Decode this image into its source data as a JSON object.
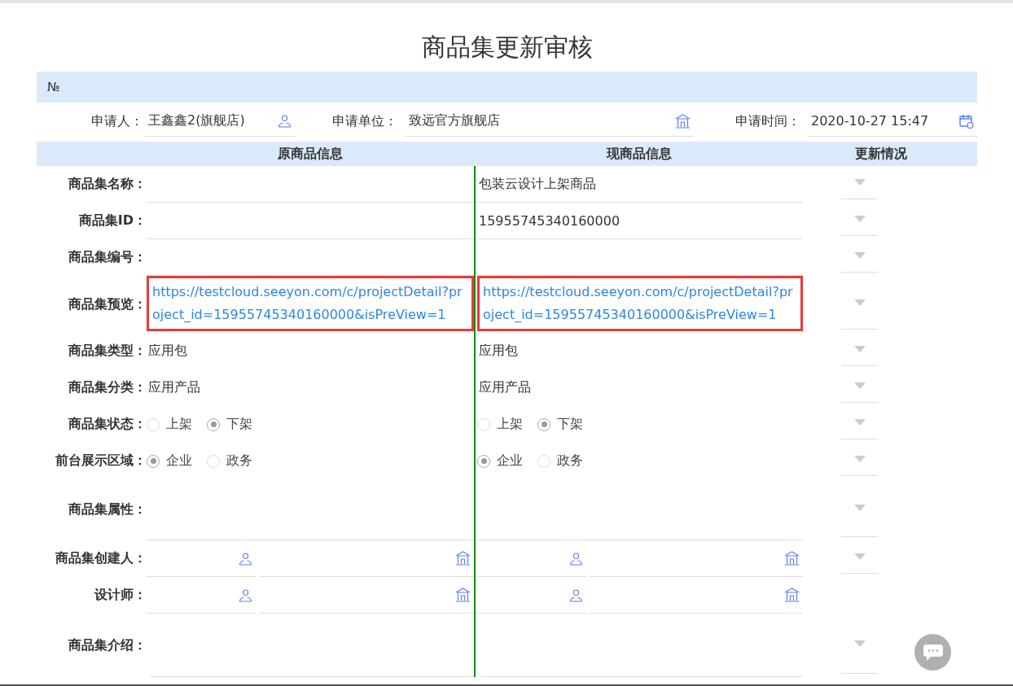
{
  "title": "商品集更新审核",
  "number_label": "№",
  "applicant_fields": [
    {
      "label": "申请人：",
      "value": "王鑫鑫2(旗舰店)"
    },
    {
      "label": "申请单位：",
      "value": "致远官方旗舰店"
    },
    {
      "label": "申请时间：",
      "value": "2020-10-27 15:47"
    }
  ],
  "headers": [
    "原商品信息",
    "现商品信息",
    "更新情况"
  ],
  "rows": [
    {
      "label": "商品集名称：",
      "kind": "text",
      "original": {},
      "current": {
        "value": "包装云设计上架商品"
      },
      "dropdown": true
    },
    {
      "label": "商品集ID：",
      "kind": "text",
      "original": {},
      "current": {
        "value": "15955745340160000"
      },
      "dropdown": true
    },
    {
      "label": "商品集编号：",
      "kind": "text",
      "original": {},
      "current": {},
      "dropdown": true
    },
    {
      "label": "商品集预览：",
      "kind": "link",
      "original": {
        "value": "https://testcloud.seeyon.com/c/projectDetail?project_id=15955745340160000&isPreView=1",
        "highlighted": true
      },
      "current": {
        "value": "https://testcloud.seeyon.com/c/projectDetail?project_id=15955745340160000&isPreView=1",
        "highlighted": true
      },
      "dropdown": true
    },
    {
      "label": "商品集类型：",
      "kind": "plain",
      "original": {
        "value": "应用包"
      },
      "current": {
        "value": "应用包"
      },
      "dropdown": true
    },
    {
      "label": "商品集分类：",
      "kind": "plain",
      "original": {
        "value": "应用产品"
      },
      "current": {
        "value": "应用产品"
      },
      "dropdown": true
    },
    {
      "label": "商品集状态：",
      "kind": "radio",
      "original": {
        "options": [
          {
            "label": "上架",
            "selected": false
          },
          {
            "label": "下架",
            "selected": true
          }
        ]
      },
      "current": {
        "options": [
          {
            "label": "上架",
            "selected": false
          },
          {
            "label": "下架",
            "selected": true
          }
        ]
      },
      "dropdown": true
    },
    {
      "label": "前台展示区域：",
      "kind": "radio",
      "original": {
        "options": [
          {
            "label": "企业",
            "selected": true
          },
          {
            "label": "政务",
            "selected": false
          }
        ]
      },
      "current": {
        "options": [
          {
            "label": "企业",
            "selected": true
          },
          {
            "label": "政务",
            "selected": false
          }
        ]
      },
      "dropdown": true
    },
    {
      "label": "商品集属性：",
      "kind": "tall",
      "original": {},
      "current": {},
      "dropdown": true
    },
    {
      "label": "商品集创建人：",
      "kind": "person_org",
      "original": {},
      "current": {},
      "dropdown": true
    },
    {
      "label": "设计师：",
      "kind": "person_org",
      "original": {},
      "current": {},
      "dropdown": false
    },
    {
      "label": "商品集介绍：",
      "kind": "textarea",
      "original": {},
      "current": {},
      "dropdown": true
    }
  ]
}
